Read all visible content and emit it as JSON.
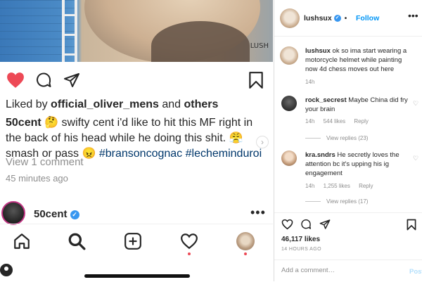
{
  "mobile": {
    "photo_watermark": "LUSH",
    "liked_by": {
      "prefix": "Liked by",
      "user": "official_oliver_mens",
      "joiner": "and",
      "others": "others"
    },
    "caption": {
      "username": "50cent",
      "line": "🤔 swifty cent i'd like to hit this MF right in the back of his head while he doing this shit. 😤 smash or pass 😠",
      "hashtags": [
        "#bransoncognac",
        "#lecheminduroi"
      ]
    },
    "view_comments": "View 1 comment",
    "time_ago": "45 minutes ago",
    "next_post": {
      "username": "50cent",
      "more": "•••"
    },
    "tabs": [
      {
        "name": "home",
        "icon": "home-icon"
      },
      {
        "name": "search",
        "icon": "search-icon"
      },
      {
        "name": "new-post",
        "icon": "plus-square-icon"
      },
      {
        "name": "activity",
        "icon": "heart-icon"
      },
      {
        "name": "profile",
        "icon": "avatar"
      }
    ],
    "colors": {
      "like_red": "#ed4956",
      "hashtag_blue": "#00376b",
      "story_ring": "#c13584"
    }
  },
  "desktop": {
    "header": {
      "username": "lushsux",
      "separator": "•",
      "follow": "Follow",
      "more": "•••"
    },
    "comments": [
      {
        "username": "lushsux",
        "text": "ok so ima start wearing a motorcycle helmet while painting now 4d chess moves out here",
        "time": "14h"
      },
      {
        "username": "rock_secrest",
        "text": "Maybe China did fry your brain",
        "time": "14h",
        "likes": "544 likes",
        "reply": "Reply",
        "view_replies": "View replies (23)"
      },
      {
        "username": "kra.sndrs",
        "text": "He secretly loves the attention bc it's upping his ig engagement",
        "time": "14h",
        "likes": "1,255 likes",
        "reply": "Reply",
        "view_replies": "View replies (17)"
      }
    ],
    "likes": "46,117 likes",
    "date": "14 HOURS AGO",
    "add_comment_placeholder": "Add a comment…",
    "post_button": "Post",
    "colors": {
      "follow_blue": "#0095f6",
      "post_disabled": "#b2dffc"
    }
  }
}
